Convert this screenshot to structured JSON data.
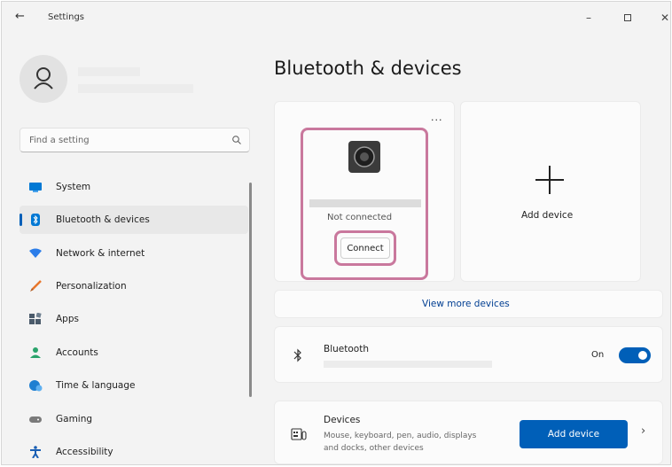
{
  "app": {
    "title": "Settings",
    "back_icon": "arrow-left-icon",
    "window_controls": [
      "minimize-icon",
      "maximize-icon",
      "close-icon"
    ]
  },
  "profile": {
    "avatar_icon": "person-icon"
  },
  "search": {
    "placeholder": "Find a setting",
    "icon": "search-icon"
  },
  "sidebar": {
    "items": [
      {
        "label": "System",
        "icon": "system-icon",
        "color": "#0078d4"
      },
      {
        "label": "Bluetooth & devices",
        "icon": "bluetooth-icon",
        "color": "#0078d4",
        "selected": true
      },
      {
        "label": "Network & internet",
        "icon": "wifi-icon",
        "color": "#2b7de9"
      },
      {
        "label": "Personalization",
        "icon": "brush-icon",
        "color": "#e8762b"
      },
      {
        "label": "Apps",
        "icon": "apps-icon",
        "color": "#4a5a6a"
      },
      {
        "label": "Accounts",
        "icon": "accounts-icon",
        "color": "#2aa36b"
      },
      {
        "label": "Time & language",
        "icon": "globe-clock-icon",
        "color": "#1f7fd1"
      },
      {
        "label": "Gaming",
        "icon": "gamepad-icon",
        "color": "#7a7a7a"
      },
      {
        "label": "Accessibility",
        "icon": "accessibility-icon",
        "color": "#1a5fb4"
      }
    ]
  },
  "main": {
    "title": "Bluetooth & devices",
    "device_card": {
      "more_label": "...",
      "status": "Not connected",
      "connect_label": "Connect",
      "icon": "speaker-icon"
    },
    "add_device_card": {
      "label": "Add device",
      "icon": "plus-icon"
    },
    "view_more_label": "View more devices",
    "bluetooth_row": {
      "label": "Bluetooth",
      "state_label": "On",
      "icon": "bluetooth-icon",
      "on": true
    },
    "devices_row": {
      "title": "Devices",
      "description_line1": "Mouse, keyboard, pen, audio, displays",
      "description_line2": "and docks, other devices",
      "button_label": "Add device",
      "icon": "keyboard-icon",
      "chevron_icon": "chevron-right-icon"
    }
  },
  "colors": {
    "accent": "#005fb8",
    "highlight": "#c9789d"
  }
}
